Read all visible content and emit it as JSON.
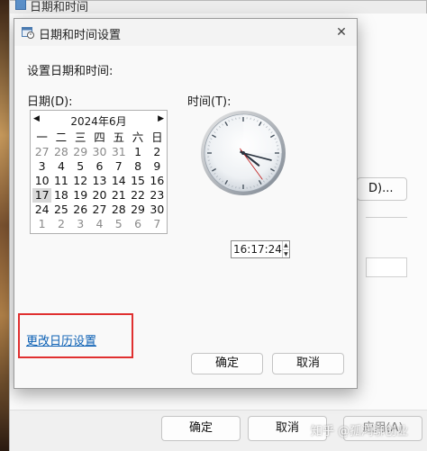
{
  "background_window": {
    "title": "日期和时间",
    "partial_button_label": "D)...",
    "ok_label": "确定",
    "cancel_label": "取消",
    "apply_label": "应用(A)"
  },
  "watermark": "知乎 @孤鸿聊创业",
  "dialog": {
    "title": "日期和时间设置",
    "close_symbol": "✕",
    "heading": "设置日期和时间:",
    "date_label": "日期(D):",
    "time_label": "时间(T):",
    "calendar": {
      "month_title": "2024年6月",
      "prev_symbol": "◀",
      "next_symbol": "▶",
      "weekdays": [
        "一",
        "二",
        "三",
        "四",
        "五",
        "六",
        "日"
      ],
      "weeks": [
        [
          "27",
          "28",
          "29",
          "30",
          "31",
          "1",
          "2"
        ],
        [
          "3",
          "4",
          "5",
          "6",
          "7",
          "8",
          "9"
        ],
        [
          "10",
          "11",
          "12",
          "13",
          "14",
          "15",
          "16"
        ],
        [
          "17",
          "18",
          "19",
          "20",
          "21",
          "22",
          "23"
        ],
        [
          "24",
          "25",
          "26",
          "27",
          "28",
          "29",
          "30"
        ],
        [
          "1",
          "2",
          "3",
          "4",
          "5",
          "6",
          "7"
        ]
      ],
      "selected_day": "17"
    },
    "clock": {
      "hour": 16,
      "minute": 17,
      "second": 24
    },
    "time_value": "16:17:24",
    "spin_up": "▲",
    "spin_down": "▼",
    "change_calendar_link": "更改日历设置",
    "ok_label": "确定",
    "cancel_label": "取消"
  },
  "colors": {
    "link": "#0a5fb4",
    "highlight_box": "#e03030",
    "selected_day_bg": "#d9d9d9"
  }
}
